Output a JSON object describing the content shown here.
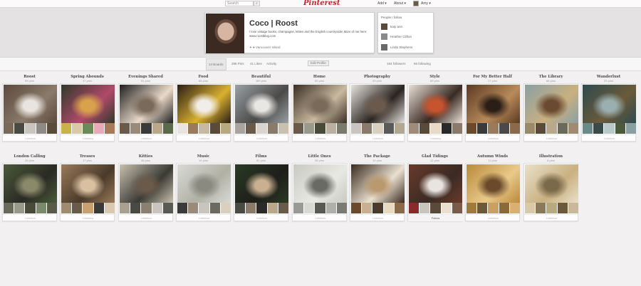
{
  "topbar": {
    "search_placeholder": "Search",
    "search_icon": "magnifier-icon",
    "logo": "Pinterest",
    "add_label": "Add",
    "about_label": "About",
    "user_label": "Amy"
  },
  "profile": {
    "name": "Coco | Roost",
    "bio": "I love vintage books, champagne, kitties and the English countryside! More of me here: www.roostblog.com",
    "location_label": "Vancouver Island"
  },
  "social": {
    "heading": "People I follow",
    "people": [
      "katy ann",
      "Heather Clifton",
      "Linda Stephens"
    ]
  },
  "tabs": {
    "boards_label": "14 Boards",
    "pins_label": "286 Pins",
    "likes_label": "41 Likes",
    "activity_label": "Activity",
    "edit_label": "Edit Profile",
    "followers_label": "184 followers",
    "following_label": "56 following"
  },
  "boards": [
    {
      "title": "Roost",
      "count": "99 pins",
      "action": "Unfollow",
      "colors": [
        "#5c4a3e",
        "#e9e4df",
        "#8a7a6a"
      ],
      "minis": [
        "#7a6a5a",
        "#4a4a44",
        "#c9c4bd",
        "#8e8a86",
        "#5a4a3a"
      ]
    },
    {
      "title": "Spring Abounds",
      "count": "37 pins",
      "action": "Unfollow",
      "colors": [
        "#2f3a2a",
        "#d9a24a",
        "#b04a6a"
      ],
      "minis": [
        "#c9b24a",
        "#d9c9a9",
        "#6a8a5a",
        "#e9a9b9",
        "#a97a5a"
      ]
    },
    {
      "title": "Evenings Shared",
      "count": "51 pins",
      "action": "Unfollow",
      "colors": [
        "#1f1f1f",
        "#7a6a5a",
        "#e9d9c9"
      ],
      "minis": [
        "#6a5a4a",
        "#9a8a7a",
        "#3a3a3a",
        "#b9a98a",
        "#5a6a4a"
      ]
    },
    {
      "title": "Food",
      "count": "68 pins",
      "action": "Unfollow",
      "colors": [
        "#2a1e16",
        "#f1ede8",
        "#d9b030"
      ],
      "minis": [
        "#e9e4df",
        "#9a7a5a",
        "#c9b9a0",
        "#5a4a3a",
        "#b9a980"
      ]
    },
    {
      "title": "Beautiful",
      "count": "183 pins",
      "action": "Unfollow",
      "colors": [
        "#9aa0a4",
        "#e9e7e4",
        "#4a4a48"
      ],
      "minis": [
        "#a9a4a0",
        "#6a5a4a",
        "#d9d4cf",
        "#8a7a6a",
        "#c9c0b0"
      ]
    },
    {
      "title": "Home",
      "count": "60 pins",
      "action": "Unfollow",
      "colors": [
        "#3a2e24",
        "#7a6a5a",
        "#c9b9a0"
      ],
      "minis": [
        "#6a5a4a",
        "#9a9a8a",
        "#4a4a3a",
        "#b9b0a0",
        "#7a7a6a"
      ]
    },
    {
      "title": "Photography",
      "count": "29 pins",
      "action": "Unfollow",
      "colors": [
        "#e6e2de",
        "#6a5a4e",
        "#2a2420"
      ],
      "minis": [
        "#c9c4bf",
        "#8a7a6a",
        "#d9d0c0",
        "#5a5a5a",
        "#b0a890"
      ]
    },
    {
      "title": "Style",
      "count": "69 pins",
      "action": "Unfollow",
      "colors": [
        "#e9e0d6",
        "#c6542e",
        "#3a2a24"
      ],
      "minis": [
        "#a08a7a",
        "#5a4a3a",
        "#e9d9c9",
        "#2a2a2a",
        "#8a7a6a"
      ]
    },
    {
      "title": "For My Better Half",
      "count": "17 pins",
      "action": "Unfollow",
      "colors": [
        "#5a3a22",
        "#2a1e16",
        "#b98a5a"
      ],
      "minis": [
        "#6a4a2a",
        "#3a3a3a",
        "#9a7a5a",
        "#4a4a4a",
        "#8a6a4a"
      ]
    },
    {
      "title": "The Library",
      "count": "68 pins",
      "action": "Unfollow",
      "colors": [
        "#8aa0a4",
        "#6a4a30",
        "#c9b080"
      ],
      "minis": [
        "#9a8a6a",
        "#5a4a3a",
        "#b9a98a",
        "#6a6a5a",
        "#a08a70"
      ]
    },
    {
      "title": "Wanderlust",
      "count": "29 pins",
      "action": "Unfollow",
      "colors": [
        "#2e4a4e",
        "#9ab0b0",
        "#6a5a3a"
      ],
      "minis": [
        "#6a8a8a",
        "#3a4a4a",
        "#b9c9c9",
        "#4a5a3a",
        "#8aa0a0"
      ]
    },
    {
      "title": "London Calling",
      "count": "26 pins",
      "action": "Unfollow",
      "colors": [
        "#4a5a3a",
        "#8a8a6a",
        "#2a2a24"
      ],
      "minis": [
        "#6a6a5a",
        "#9a9a8a",
        "#4a4a3a",
        "#7a8a6a",
        "#5a5a4a"
      ]
    },
    {
      "title": "Tresses",
      "count": "17 pins",
      "action": "Unfollow",
      "colors": [
        "#9a7a5a",
        "#d9c0a0",
        "#4a3a2a"
      ],
      "minis": [
        "#a08a70",
        "#6a5a4a",
        "#c9a070",
        "#3a3a3a",
        "#d9c9b0"
      ]
    },
    {
      "title": "Kitties",
      "count": "35 pins",
      "action": "Unfollow",
      "colors": [
        "#c9c0b0",
        "#6a5a4a",
        "#3a3a34"
      ],
      "minis": [
        "#a9a090",
        "#4a4a44",
        "#8a8070",
        "#c9c4bd",
        "#5a5a54"
      ]
    },
    {
      "title": "Music",
      "count": "19 pins",
      "action": "Unfollow",
      "colors": [
        "#d9dad6",
        "#8a8a80",
        "#b0b0a4"
      ],
      "minis": [
        "#3a3a3a",
        "#9a8a7a",
        "#c9c4bd",
        "#6a6a60",
        "#d9d0c0"
      ]
    },
    {
      "title": "Films",
      "count": "51 pins",
      "action": "Unfollow",
      "colors": [
        "#2a3a24",
        "#c9b090",
        "#1e1e1a"
      ],
      "minis": [
        "#4a4a44",
        "#8a7a6a",
        "#2a2a2a",
        "#b9a98a",
        "#6a5a4a"
      ]
    },
    {
      "title": "Little Ones",
      "count": "38 pins",
      "action": "Unfollow",
      "colors": [
        "#c9c9c4",
        "#6a6a64",
        "#e9e9e4"
      ],
      "minis": [
        "#9a9a94",
        "#d9d9d4",
        "#5a5a54",
        "#b0b0aa",
        "#7a7a74"
      ]
    },
    {
      "title": "The Package",
      "count": "14 pins",
      "action": "Unfollow",
      "colors": [
        "#3a2a20",
        "#b99a70",
        "#e9e0d0"
      ],
      "minis": [
        "#6a4a2a",
        "#c9b090",
        "#4a3a2a",
        "#e9d9c0",
        "#8a6a4a"
      ]
    },
    {
      "title": "Glad Tidings",
      "count": "12 pins",
      "action": "Follow",
      "colors": [
        "#6a3a2a",
        "#e9e4df",
        "#3a2a24"
      ],
      "minis": [
        "#8a2a2a",
        "#c9c4bd",
        "#5a4a3a",
        "#e9e0d0",
        "#7a5a4a"
      ]
    },
    {
      "title": "Autumn Winds",
      "count": "11 pins",
      "action": "Unfollow",
      "colors": [
        "#b98a3a",
        "#6a4a2a",
        "#e9c98a"
      ],
      "minis": [
        "#a07a3a",
        "#6a5a3a",
        "#c9a060",
        "#8a6a3a",
        "#d9b070"
      ]
    },
    {
      "title": "Illustration",
      "count": "8 pins",
      "action": "Unfollow",
      "colors": [
        "#e9e0c9",
        "#7a6a4a",
        "#c9b080"
      ],
      "minis": [
        "#d9c9a9",
        "#8a7a5a",
        "#b9a980",
        "#6a5a3a",
        "#c9b99a"
      ]
    }
  ]
}
